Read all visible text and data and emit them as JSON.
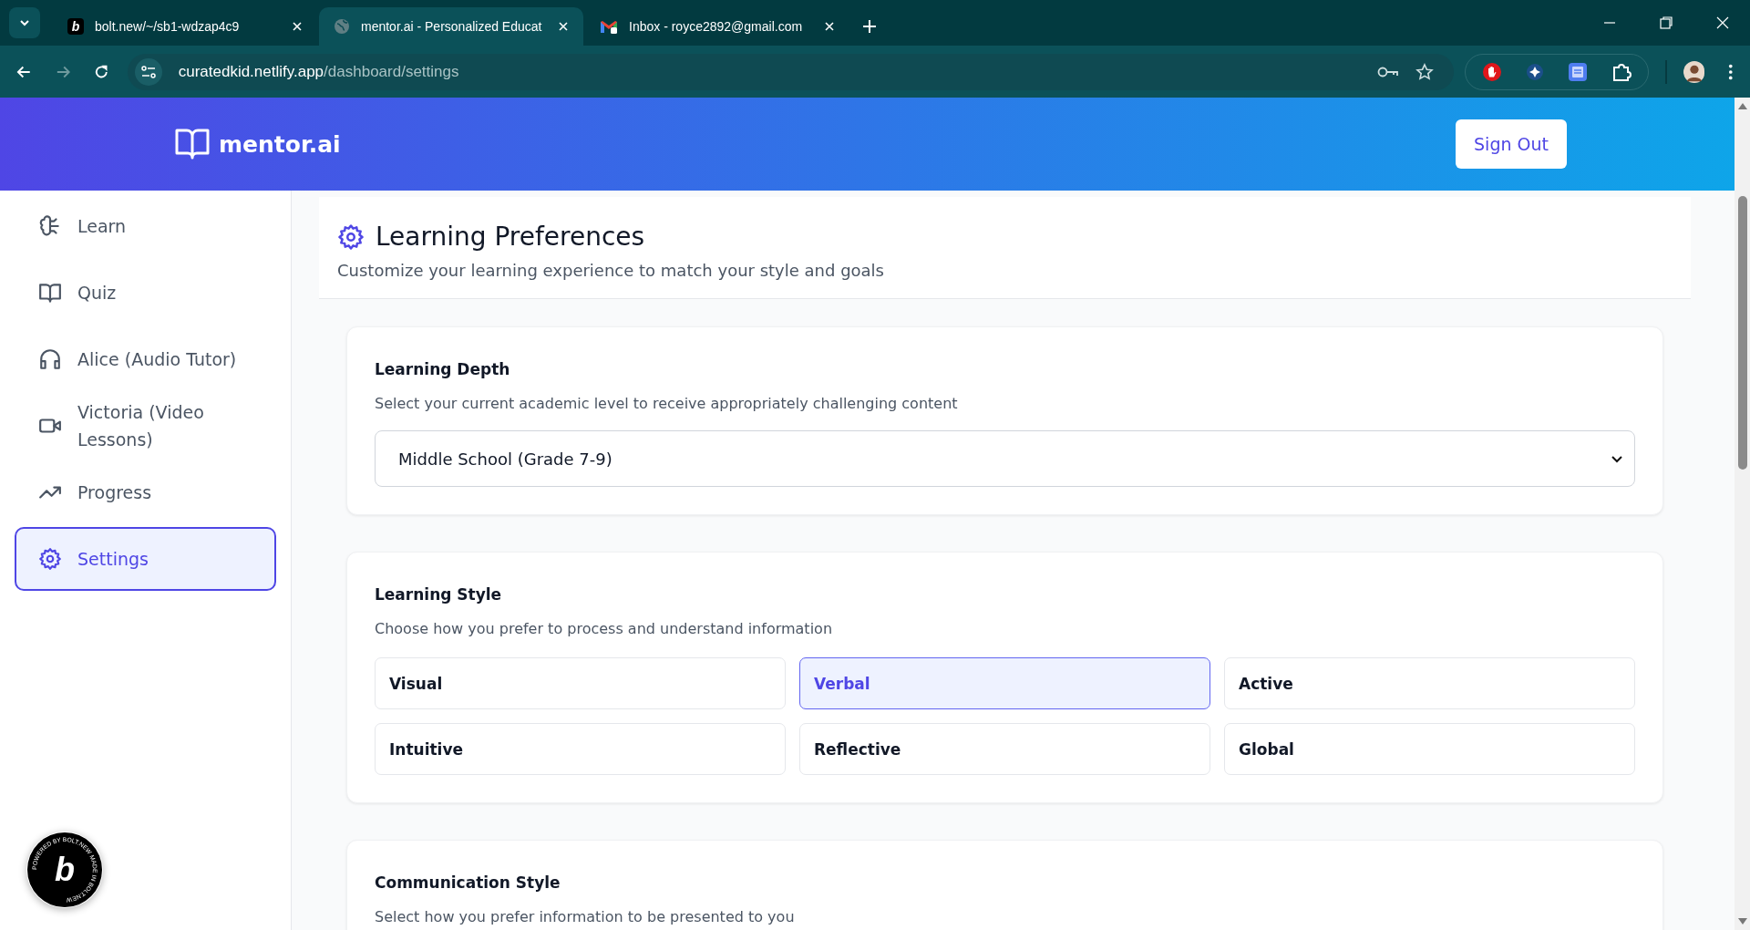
{
  "browser": {
    "tabs": [
      {
        "title": "bolt.new/~/sb1-wdzap4c9",
        "favicon_text": "b",
        "selected": false
      },
      {
        "title": "mentor.ai - Personalized Educat",
        "selected": true
      },
      {
        "title": "Inbox - royce2892@gmail.com",
        "selected": false
      }
    ],
    "address": {
      "host": "curatedkid.netlify.app",
      "path": "/dashboard/settings"
    }
  },
  "header": {
    "brand": "mentor.ai",
    "sign_out": "Sign Out"
  },
  "sidebar": {
    "items": [
      {
        "label": "Learn",
        "selected": false
      },
      {
        "label": "Quiz",
        "selected": false
      },
      {
        "label": "Alice (Audio Tutor)",
        "selected": false
      },
      {
        "label": "Victoria (Video Lessons)",
        "selected": false
      },
      {
        "label": "Progress",
        "selected": false
      },
      {
        "label": "Settings",
        "selected": true
      }
    ]
  },
  "page": {
    "title": "Learning Preferences",
    "subtitle": "Customize your learning experience to match your style and goals"
  },
  "sections": [
    {
      "kind": "select",
      "title": "Learning Depth",
      "description": "Select your current academic level to receive appropriately challenging content",
      "value": "Middle School (Grade 7-9)"
    },
    {
      "kind": "options",
      "title": "Learning Style",
      "description": "Choose how you prefer to process and understand information",
      "options": [
        {
          "label": "Visual",
          "selected": false
        },
        {
          "label": "Verbal",
          "selected": true
        },
        {
          "label": "Active",
          "selected": false
        },
        {
          "label": "Intuitive",
          "selected": false
        },
        {
          "label": "Reflective",
          "selected": false
        },
        {
          "label": "Global",
          "selected": false
        }
      ]
    },
    {
      "kind": "text",
      "title": "Communication Style",
      "description": "Select how you prefer information to be presented to you"
    }
  ],
  "badge": {
    "ring_text": "POWERED BY BOLT.NEW MADE IN BOLT.NEW",
    "letter": "b"
  }
}
